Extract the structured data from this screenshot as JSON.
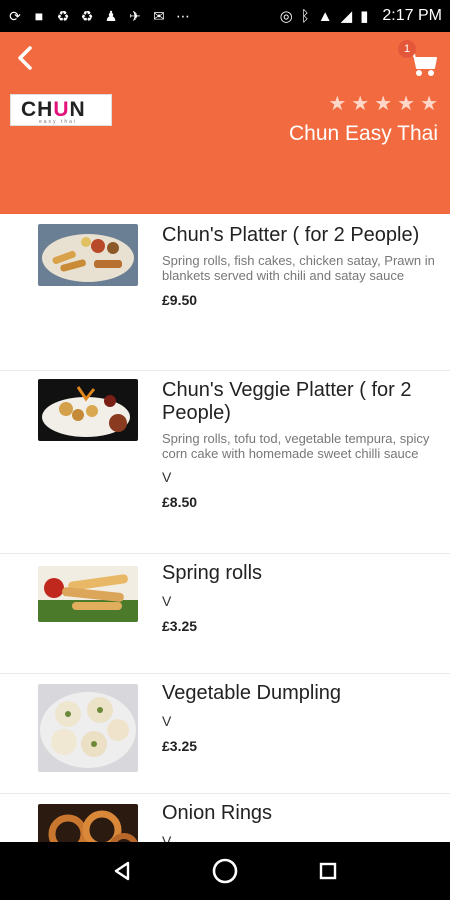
{
  "status_bar": {
    "time": "2:17 PM"
  },
  "header": {
    "cart_count": "1",
    "logo_text_pre": "CH",
    "logo_text_u": "U",
    "logo_text_post": "N",
    "logo_subtext": "easy thai",
    "rating_stars": 5,
    "restaurant_name": "Chun Easy Thai",
    "accent_color": "#f26a3f"
  },
  "menu": {
    "items": [
      {
        "name": "Chun's Platter ( for 2 People)",
        "description": "Spring rolls, fish cakes, chicken satay, Prawn in blankets served with chili and satay sauce",
        "tag": "",
        "price": "£9.50"
      },
      {
        "name": "Chun's Veggie Platter ( for 2 People)",
        "description": "Spring rolls, tofu tod, vegetable tempura, spicy corn cake with homemade  sweet chilli sauce",
        "tag": "V",
        "price": "£8.50"
      },
      {
        "name": "Spring rolls",
        "description": "",
        "tag": "V",
        "price": "£3.25"
      },
      {
        "name": "Vegetable Dumpling",
        "description": "",
        "tag": "V",
        "price": "£3.25"
      },
      {
        "name": "Onion Rings",
        "description": "",
        "tag": "V",
        "price": ""
      }
    ]
  }
}
